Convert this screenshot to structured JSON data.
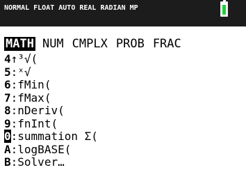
{
  "status_bar": {
    "text": "NORMAL FLOAT AUTO REAL RADIAN MP",
    "battery_icon": "battery-full-icon",
    "battery_color": "#1fcf3a"
  },
  "tabs": [
    {
      "label": "MATH",
      "selected": true
    },
    {
      "label": "NUM",
      "selected": false
    },
    {
      "label": "CMPLX",
      "selected": false
    },
    {
      "label": "PROB",
      "selected": false
    },
    {
      "label": "FRAC",
      "selected": false
    }
  ],
  "menu_items": [
    {
      "key": "4",
      "sep": "↑",
      "label": "³√("
    },
    {
      "key": "5",
      "sep": ":",
      "label": "ˣ√"
    },
    {
      "key": "6",
      "sep": ":",
      "label": "fMin("
    },
    {
      "key": "7",
      "sep": ":",
      "label": "fMax("
    },
    {
      "key": "8",
      "sep": ":",
      "label": "nDeriv("
    },
    {
      "key": "9",
      "sep": ":",
      "label": "fnInt("
    },
    {
      "key": "0",
      "sep": ":",
      "label": "summation Σ(",
      "selected": true
    },
    {
      "key": "A",
      "sep": ":",
      "label": "logBASE("
    },
    {
      "key": "B",
      "sep": ":",
      "label": "Solver…"
    }
  ]
}
